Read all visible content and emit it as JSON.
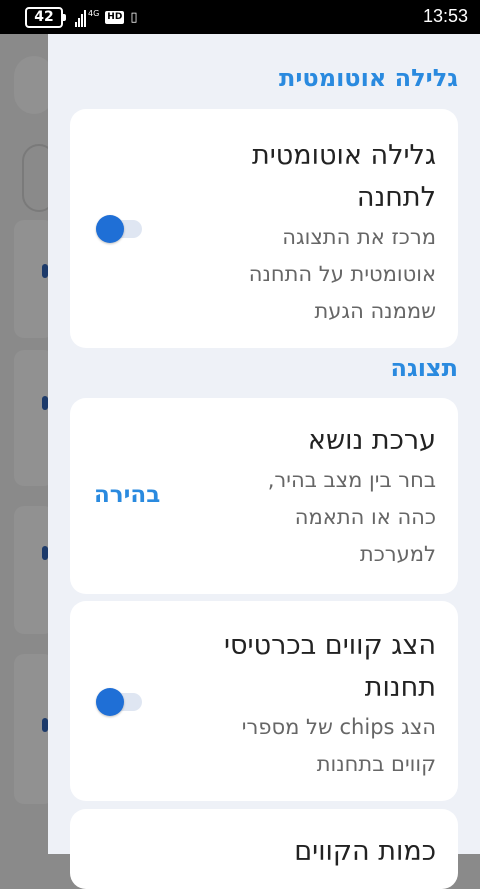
{
  "status_bar": {
    "battery": "42",
    "network": "4G",
    "hd": "HD",
    "vibrate_icon": "vibrate-icon",
    "time": "13:53"
  },
  "sections": {
    "auto_scroll": {
      "title": "גלילה אוטומטית",
      "card": {
        "title_line1": "גלילה אוטומטית",
        "title_line2": "לתחנה",
        "desc_line1": "מרכז את התצוגה",
        "desc_line2": "אוטומטית על התחנה",
        "desc_line3": "שממנה הגעת",
        "toggle_on": false
      }
    },
    "display": {
      "title": "תצוגה",
      "theme_card": {
        "title": "ערכת נושא",
        "desc_line1": "בחר בין מצב בהיר,",
        "desc_line2": "כהה או התאמה",
        "desc_line3": "למערכת",
        "value": "בהירה"
      },
      "lines_card": {
        "title_line1": "הצג קווים בכרטיסי",
        "title_line2": "תחנות",
        "desc_line1": "הצג chips של מספרי",
        "desc_line2": "קווים בתחנות",
        "toggle_on": false
      },
      "next_card": {
        "title": "כמות הקווים"
      }
    }
  },
  "colors": {
    "accent": "#2a8adf",
    "toggle_thumb": "#1f6fd6",
    "sheet_bg": "#eef1f7",
    "card_bg": "#ffffff"
  }
}
